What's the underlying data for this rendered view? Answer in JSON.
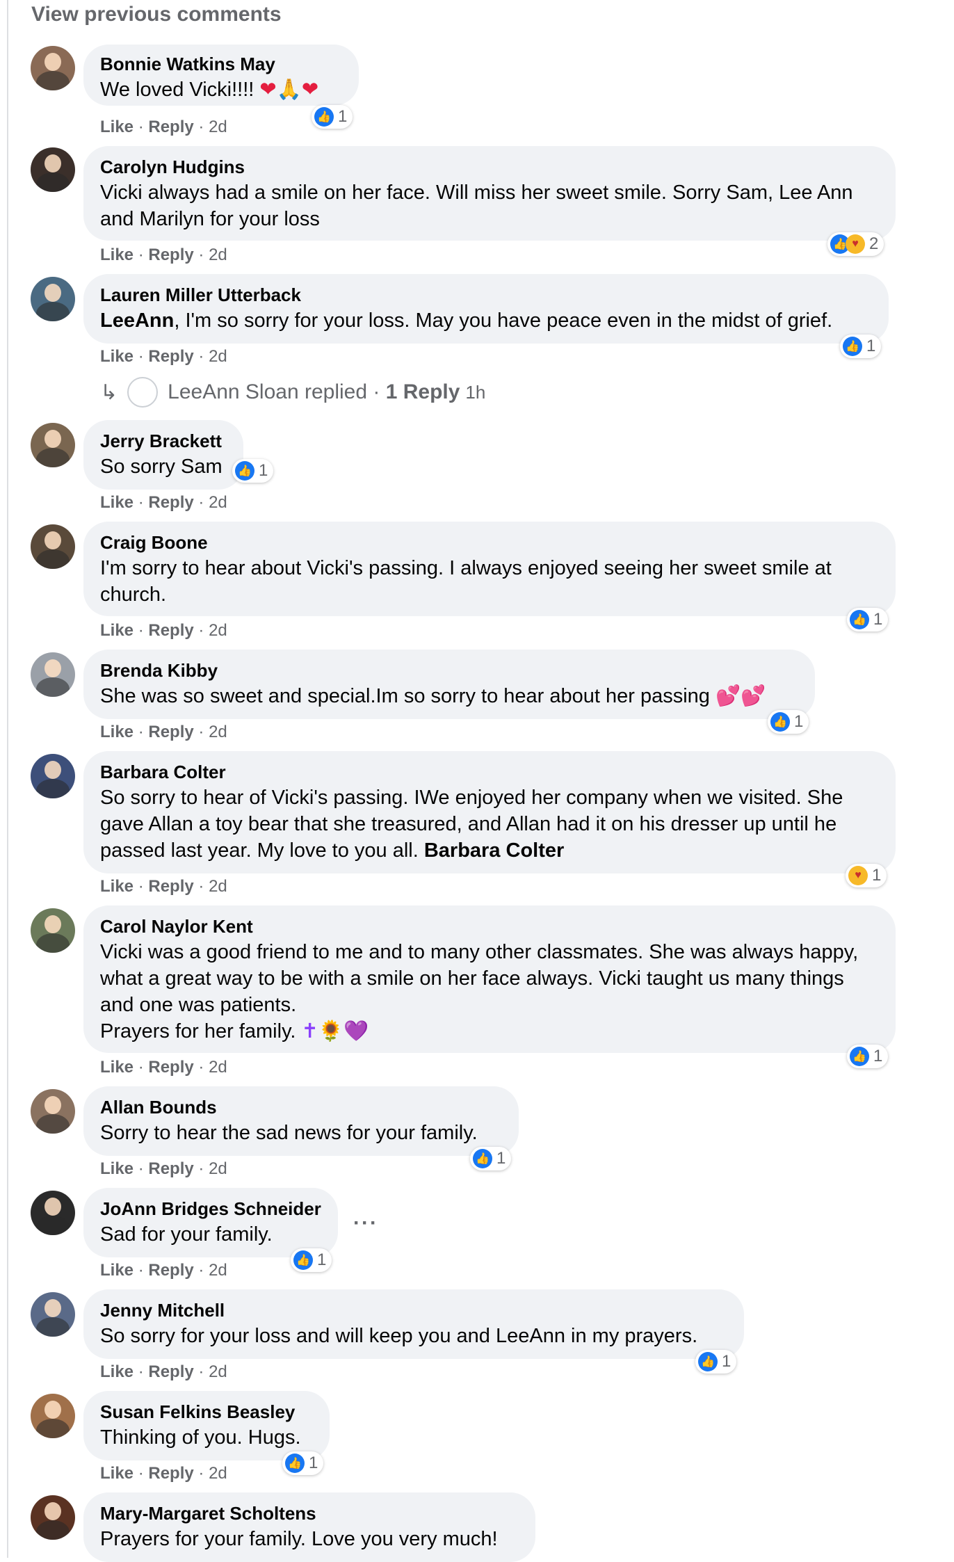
{
  "view_previous": "View previous comments",
  "action_like": "Like",
  "action_reply": "Reply",
  "sep": "·",
  "comments": [
    {
      "name": "Bonnie Watkins May",
      "text": "We loved Vicki!!!! ",
      "emoji": "❤🙏❤",
      "time": "2d",
      "reactions": "1",
      "avatar_color": "#8a6a55"
    },
    {
      "name": "Carolyn Hudgins",
      "text": "Vicki always had a smile on her face. Will miss her sweet smile. Sorry Sam, Lee Ann and Marilyn for your loss",
      "time": "2d",
      "reactions": "2",
      "avatar_color": "#3b2f2a"
    },
    {
      "name": "Lauren Miller Utterback",
      "mention": "LeeAnn",
      "text": ", I'm so sorry for your loss. May you have peace even in the midst of grief.",
      "time": "2d",
      "reactions": "1",
      "avatar_color": "#4a6a82"
    },
    {
      "name": "Jerry Brackett",
      "text": "So sorry Sam",
      "time": "2d",
      "reactions": "1",
      "avatar_color": "#7a6650"
    },
    {
      "name": "Craig Boone",
      "text": "I'm sorry to hear about Vicki's passing. I always enjoyed seeing her sweet smile at church.",
      "time": "2d",
      "reactions": "1",
      "avatar_color": "#5a4a3a"
    },
    {
      "name": "Brenda Kibby",
      "text": "She was so sweet and special.Im so sorry to hear about her passing ",
      "emoji": "💕💕",
      "time": "2d",
      "reactions": "1",
      "avatar_color": "#9aa0a8"
    },
    {
      "name": "Barbara Colter",
      "text": "So sorry to hear of Vicki's passing. IWe enjoyed her company when we visited. She gave Allan a toy bear that she treasured, and Allan had it on his dresser up until he passed last year. My love to you all. ",
      "signature": "Barbara Colter",
      "time": "2d",
      "reactions": "1",
      "avatar_color": "#3d4f7a"
    },
    {
      "name": "Carol Naylor Kent",
      "text": "Vicki was a good friend to me and to many other classmates. She was always happy, what a great way to be with a smile on her face always. Vicki taught us many things and one was patients.",
      "text2": "Prayers for her family. ",
      "emoji": "✝🌻💜",
      "time": "2d",
      "reactions": "1",
      "avatar_color": "#6b7a5a"
    },
    {
      "name": "Allan Bounds",
      "text": "Sorry to hear the sad news for your family.",
      "time": "2d",
      "reactions": "1",
      "avatar_color": "#8a7260"
    },
    {
      "name": "JoAnn Bridges Schneider",
      "text": "Sad for your family.",
      "time": "2d",
      "reactions": "1",
      "avatar_color": "#2a2a2a"
    },
    {
      "name": "Jenny Mitchell",
      "text": "So sorry for your loss and will keep you and LeeAnn in my prayers.",
      "time": "2d",
      "reactions": "1",
      "avatar_color": "#5a6a88"
    },
    {
      "name": "Susan Felkins Beasley",
      "text": "Thinking of you. Hugs.",
      "time": "2d",
      "reactions": "1",
      "avatar_color": "#a0704a"
    },
    {
      "name": "Mary-Margaret Scholtens",
      "text": "Prayers for your family. Love you very much!",
      "avatar_color": "#5a3222"
    }
  ],
  "reply_thread": {
    "who": "LeeAnn Sloan replied",
    "sep": " · ",
    "count": "1 Reply",
    "time": "1h"
  },
  "more_menu": "···"
}
